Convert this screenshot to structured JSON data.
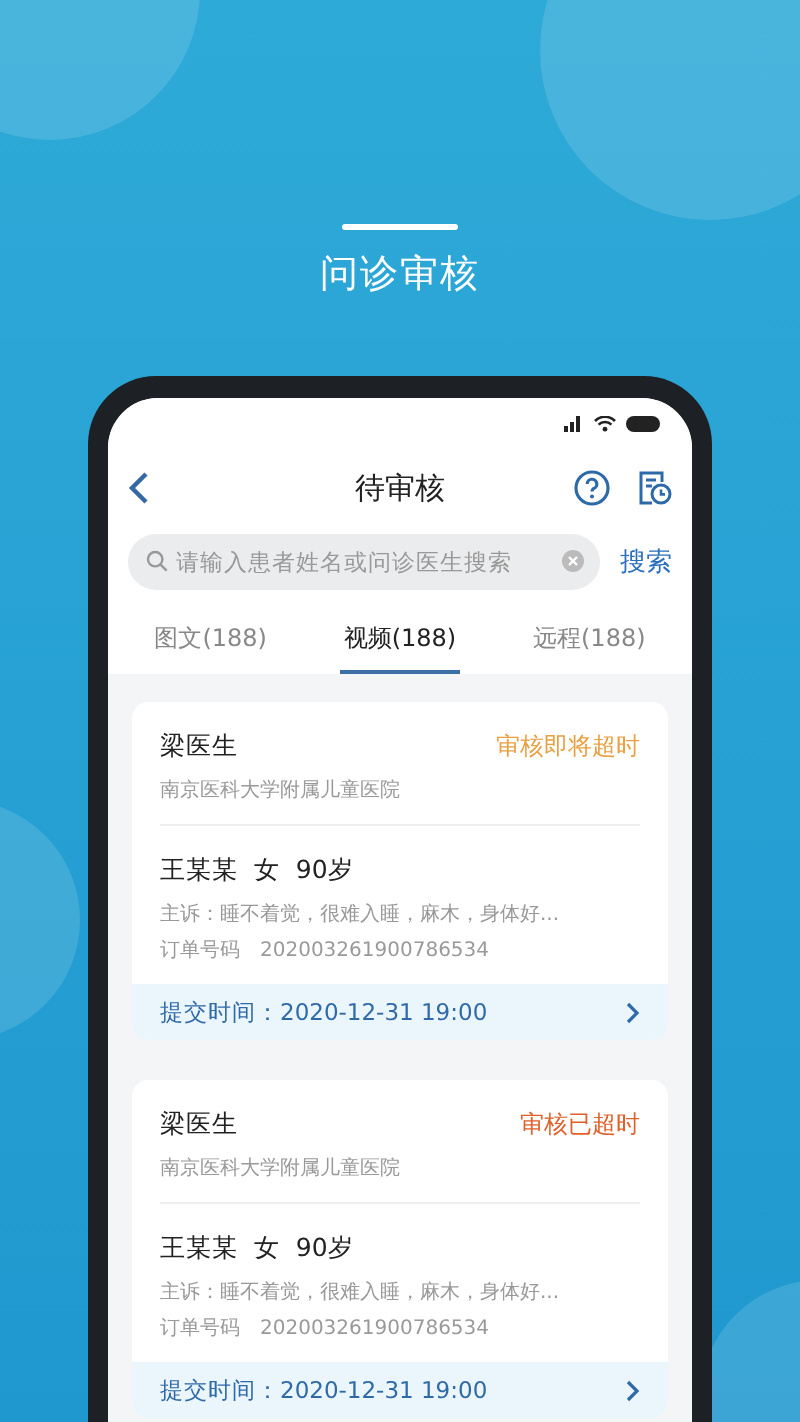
{
  "page_title": "问诊审核",
  "nav": {
    "title": "待审核"
  },
  "search": {
    "placeholder": "请输入患者姓名或问诊医生搜索",
    "button": "搜索"
  },
  "tabs": [
    {
      "label": "图文(188)",
      "selected": false
    },
    {
      "label": "视频(188)",
      "selected": true
    },
    {
      "label": "远程(188)",
      "selected": false
    }
  ],
  "cards": [
    {
      "doctor": "梁医生",
      "hospital": "南京医科大学附属儿童医院",
      "status": "审核即将超时",
      "color": "#e8a040",
      "patient": "王某某  女  90岁",
      "complaint": "主诉：睡不着觉，很难入睡，麻木，身体好...",
      "order_label": "订单号码",
      "order_no": "20200326190078653​4",
      "submitted": "提交时间：2020-12-31 19:00"
    },
    {
      "doctor": "梁医生",
      "hospital": "南京医科大学附属儿童医院",
      "status": "审核已超时",
      "color": "#e0602a",
      "patient": "王某某  女  90岁",
      "complaint": "主诉：睡不着觉，很难入睡，麻木，身体好...",
      "order_label": "订单号码",
      "order_no": "20200326190078653​4",
      "submitted": "提交时间：2020-12-31 19:00"
    }
  ]
}
